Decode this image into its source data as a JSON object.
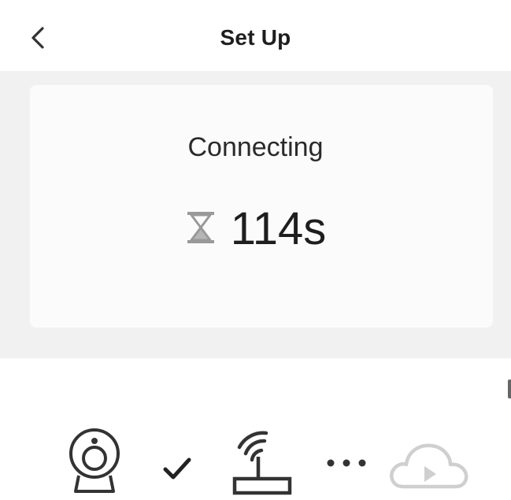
{
  "header": {
    "title": "Set Up",
    "back_icon": "chevron-left-icon"
  },
  "status": {
    "label": "Connecting",
    "timer_icon": "hourglass-icon",
    "countdown": "114s"
  },
  "steps": [
    {
      "icon": "camera-icon",
      "state": "active"
    },
    {
      "icon": "checkmark-icon",
      "state": "done"
    },
    {
      "icon": "router-icon",
      "state": "active"
    },
    {
      "icon": "dots-icon",
      "state": "in-progress"
    },
    {
      "icon": "cloud-play-icon",
      "state": "pending"
    }
  ],
  "colors": {
    "background": "#f1f1f1",
    "card": "#fbfbfb",
    "text": "#222222",
    "icon_active": "#333333",
    "icon_pending": "#cccccc",
    "hourglass": "#999999"
  }
}
